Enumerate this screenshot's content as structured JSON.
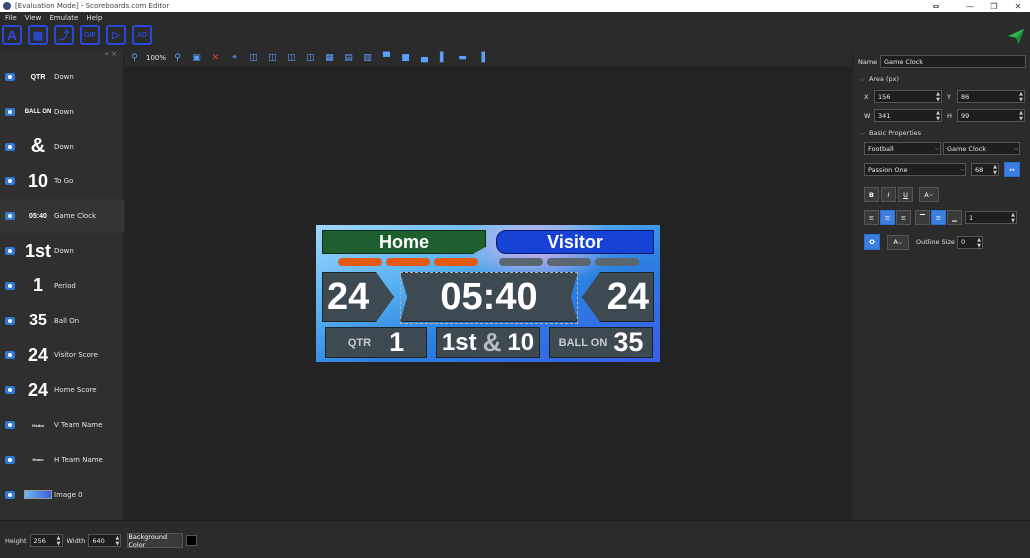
{
  "window": {
    "title": "[Evaluation Mode] - Scoreboards.com Editor",
    "controls": [
      "—",
      "❐",
      "✕"
    ]
  },
  "menu": [
    "File",
    "View",
    "Emulate",
    "Help"
  ],
  "toolbar": {
    "tools": [
      "A",
      "▦",
      "⤴",
      "GIF",
      "▷",
      "AD"
    ]
  },
  "layers_header": "« ×",
  "layers": [
    {
      "thumb": "QTR",
      "name": "Down"
    },
    {
      "thumb": "BALL ON",
      "name": "Down"
    },
    {
      "thumb": "&",
      "name": "Down"
    },
    {
      "thumb": "10",
      "name": "To Go"
    },
    {
      "thumb": "05:40",
      "name": "Game Clock"
    },
    {
      "thumb": "1st",
      "name": "Down"
    },
    {
      "thumb": "1",
      "name": "Period"
    },
    {
      "thumb": "35",
      "name": "Ball On"
    },
    {
      "thumb": "24",
      "name": "Visitor Score"
    },
    {
      "thumb": "24",
      "name": "Home Score"
    },
    {
      "thumb": "Visitor",
      "name": "V Team Name"
    },
    {
      "thumb": "Home",
      "name": "H Team Name"
    },
    {
      "thumb": "",
      "name": "Image 0"
    }
  ],
  "selected_layer": "Game Clock",
  "canvas_toolbar": {
    "zoom": "100%"
  },
  "scoreboard": {
    "home_name": "Home",
    "visitor_name": "Visitor",
    "home_score": "24",
    "visitor_score": "24",
    "clock": "05:40",
    "qtr_label": "QTR",
    "qtr_value": "1",
    "down": "1st",
    "amp": "&",
    "to_go": "10",
    "ball_on_label": "BALL ON",
    "ball_on_value": "35",
    "colors": {
      "home": "#1f5e2e",
      "visitor": "#1642d6",
      "box": "#3e4a52",
      "timeout_home": "#e35a10",
      "timeout_visitor": "#5a6670"
    }
  },
  "properties": {
    "name_label": "Name",
    "name_value": "Game Clock",
    "area_label": "Area (px)",
    "x_label": "X",
    "x_value": "156",
    "y_label": "Y",
    "y_value": "86",
    "w_label": "W",
    "w_value": "341",
    "h_label": "H",
    "h_value": "99",
    "basic_label": "Basic Properties",
    "sport": "Football",
    "field_type": "Game Clock",
    "font": "Passion One",
    "font_size": "68",
    "bold": "B",
    "italic": "I",
    "underline": "U",
    "text_color": "A",
    "line_spacing": "1",
    "outline_icon": "O",
    "outline_label": "Outline Size",
    "outline_value": "0"
  },
  "bottom": {
    "height_label": "Height",
    "height_value": "256",
    "width_label": "Width",
    "width_value": "640",
    "bg_button": "Background Color",
    "bg_color": "#000000"
  }
}
